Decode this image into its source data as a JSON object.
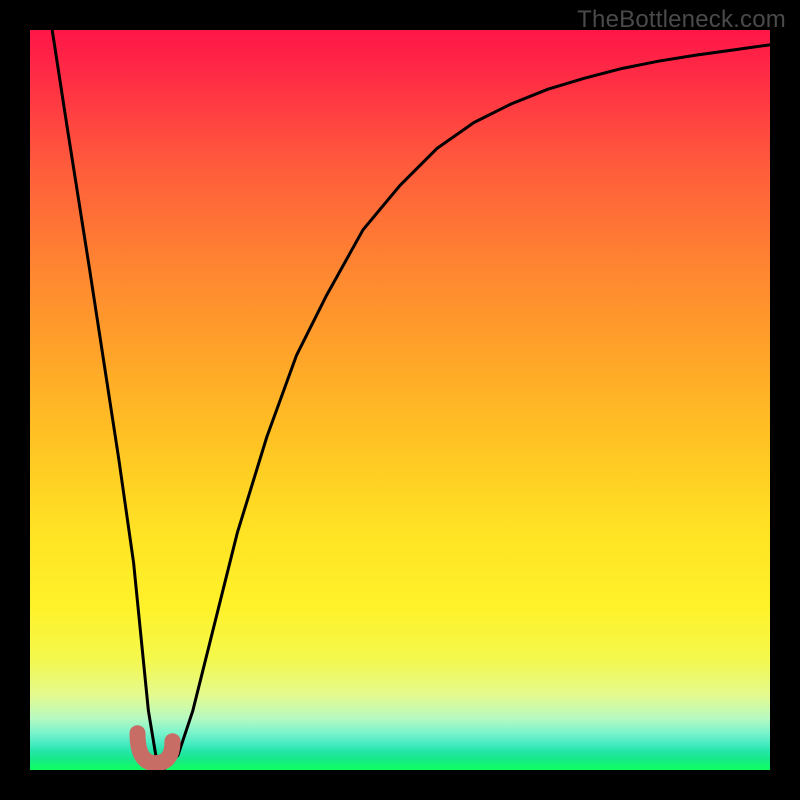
{
  "watermark": "TheBottleneck.com",
  "chart_data": {
    "type": "line",
    "title": "",
    "xlabel": "",
    "ylabel": "",
    "xlim": [
      0,
      100
    ],
    "ylim": [
      0,
      100
    ],
    "grid": false,
    "series": [
      {
        "name": "bottleneck-curve",
        "x": [
          3.0,
          5.0,
          8.0,
          10.0,
          12.0,
          14.0,
          15.0,
          16.0,
          17.0,
          18.0,
          20.0,
          22.0,
          25.0,
          28.0,
          32.0,
          36.0,
          40.0,
          45.0,
          50.0,
          55.0,
          60.0,
          65.0,
          70.0,
          75.0,
          80.0,
          85.0,
          90.0,
          95.0,
          100.0
        ],
        "y": [
          100,
          87,
          68,
          55,
          42,
          28,
          18,
          8,
          2,
          0,
          2,
          8,
          20,
          32,
          45,
          56,
          64,
          73,
          79,
          84,
          87.5,
          90,
          92,
          93.5,
          94.8,
          95.8,
          96.6,
          97.3,
          98.0
        ]
      }
    ],
    "annotations": [
      {
        "name": "j-mark",
        "x": 17.5,
        "y": 2,
        "shape": "J",
        "color": "#c86c66"
      }
    ]
  }
}
